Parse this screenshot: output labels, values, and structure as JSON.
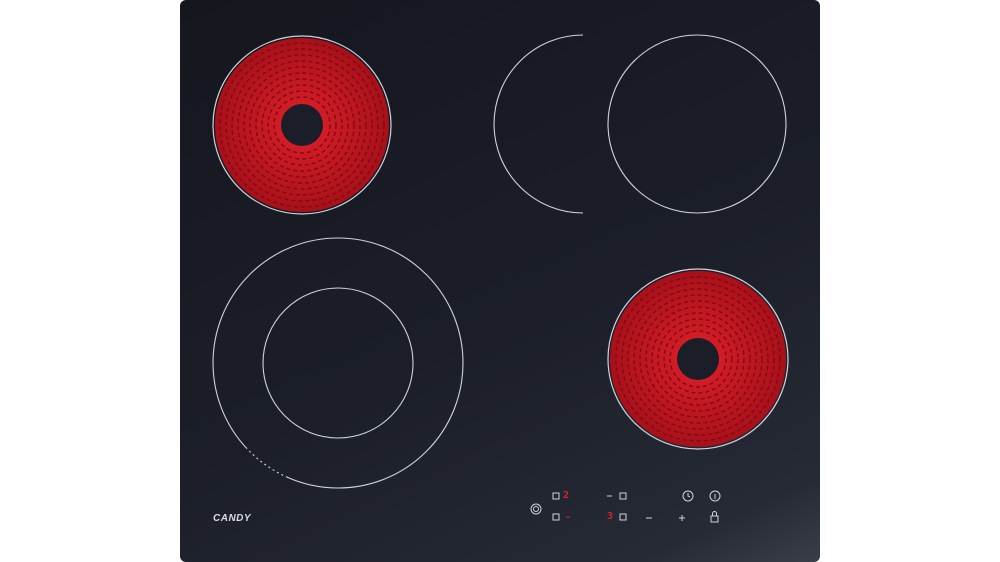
{
  "brand": {
    "logo_text": "CANDY"
  },
  "controls": {
    "zone_display_top": "2",
    "zone_display_bottom": "3"
  },
  "icons": [
    "power-icon",
    "timer-icon",
    "info-icon",
    "minus-icon",
    "plus-icon",
    "lock-icon",
    "zone-select-icon"
  ],
  "colors": {
    "glass": "#1b1e28",
    "heated_zone": "#c8141e",
    "outline": "#cfd3da",
    "display": "#e0202a"
  }
}
